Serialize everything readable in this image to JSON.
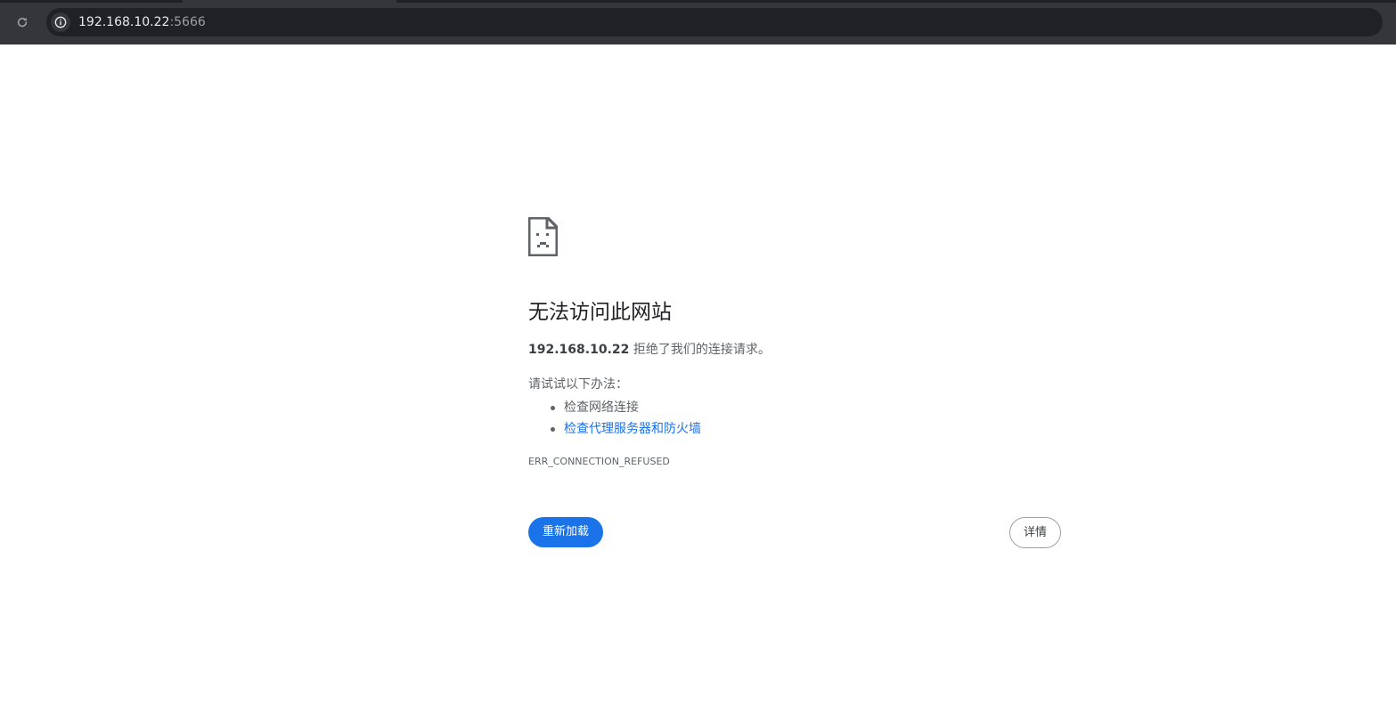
{
  "browser": {
    "reload_icon": "reload-icon",
    "info_icon": "info-icon",
    "url_host": "192.168.10.22",
    "url_port": ":5666"
  },
  "error": {
    "icon": "sad-page-icon",
    "title": "无法访问此网站",
    "host": "192.168.10.22",
    "summary_text": " 拒绝了我们的连接请求。",
    "suggestions_heading": "请试试以下办法：",
    "suggestions": [
      {
        "label": "检查网络连接",
        "is_link": false
      },
      {
        "label": "检查代理服务器和防火墙",
        "is_link": true
      }
    ],
    "code": "ERR_CONNECTION_REFUSED"
  },
  "buttons": {
    "reload_label": "重新加载",
    "details_label": "详情"
  },
  "colors": {
    "topbar": "#35363a",
    "omnibox": "#202124",
    "accent": "#1a73e8",
    "text": "#5f6368"
  }
}
